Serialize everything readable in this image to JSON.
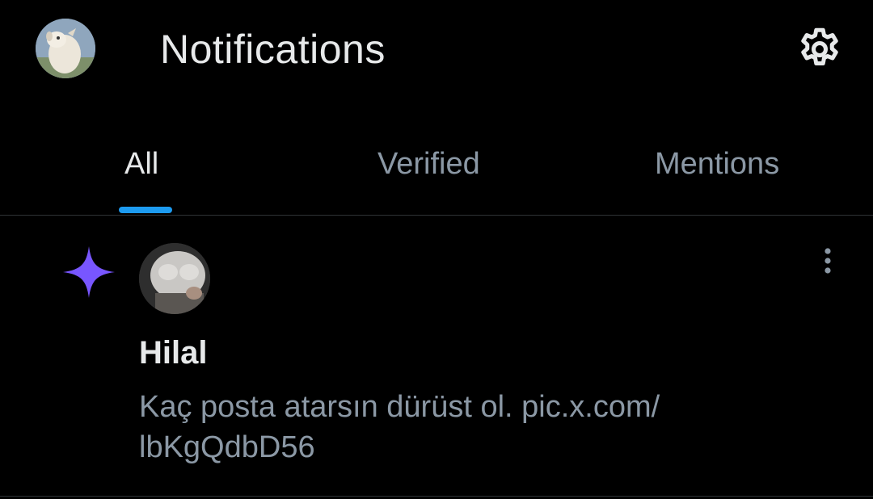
{
  "header": {
    "title": "Notifications",
    "avatar_icon": "profile-avatar-goat",
    "settings_icon": "gear-icon"
  },
  "tabs": [
    {
      "label": "All",
      "active": true
    },
    {
      "label": "Verified",
      "active": false
    },
    {
      "label": "Mentions",
      "active": false
    }
  ],
  "notification": {
    "type_icon": "sparkle-icon",
    "type_icon_color": "#7856ff",
    "avatar_icon": "user-avatar",
    "user_name": "Hilal",
    "text_line1": "Kaç posta atarsın dürüst ol. pic.x.com/",
    "text_line2": "lbKgQdbD56",
    "more_icon": "more-vertical-icon"
  },
  "colors": {
    "background": "#000000",
    "accent": "#1d9bf0",
    "primary_text": "#e7e9ea",
    "secondary_text": "#8b98a5",
    "divider": "#2f3336"
  }
}
